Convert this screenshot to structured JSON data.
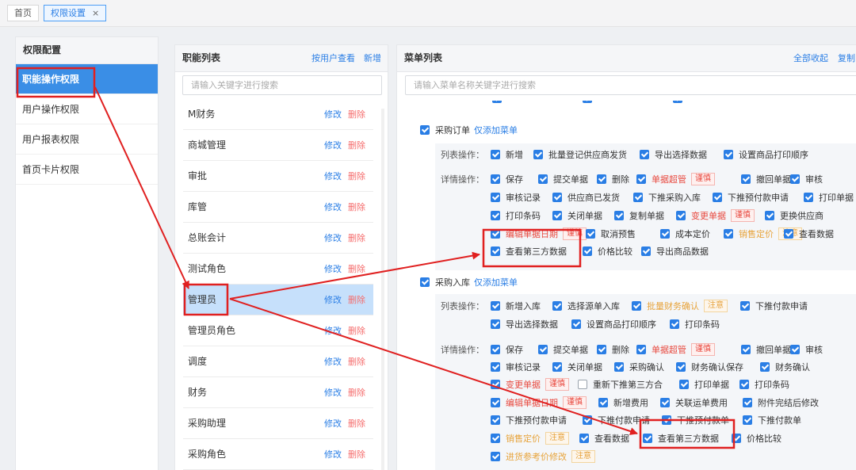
{
  "tabs": [
    {
      "label": "首页"
    },
    {
      "label": "权限设置",
      "close": "×"
    }
  ],
  "left_panel": {
    "title": "权限配置",
    "items": [
      "职能操作权限",
      "用户操作权限",
      "用户报表权限",
      "首页卡片权限"
    ]
  },
  "roles_panel": {
    "title": "职能列表",
    "by_user": "按用户查看",
    "add": "新增",
    "search_placeholder": "请输入关键字进行搜索",
    "edit_label": "修改",
    "delete_label": "删除",
    "roles": [
      "M财务",
      "商城管理",
      "审批",
      "库管",
      "总账会计",
      "测试角色",
      "管理员",
      "管理员角色",
      "调度",
      "财务",
      "采购助理",
      "采购角色"
    ]
  },
  "menu_panel": {
    "title": "菜单列表",
    "collapse_all": "全部收起",
    "copy": "复制",
    "search_placeholder": "请输入菜单名称关键字进行搜索",
    "list_ops_label": "列表操作：",
    "detail_ops_label": "详情操作：",
    "only_add_menu": "仅添加菜单",
    "purchase_order": {
      "title": "采购订单",
      "list_ops": [
        "新增",
        "批量登记供应商发货",
        "导出选择数据",
        "设置商品打印顺序"
      ],
      "detail_ops": [
        [
          "保存",
          "提交单据",
          "删除",
          "单据超管",
          "撤回单据",
          "审核"
        ],
        [
          "审核记录",
          "供应商已发货",
          "下推采购入库",
          "下推预付款申请",
          "打印单据"
        ],
        [
          "打印条码",
          "关闭单据",
          "复制单据",
          "变更单据",
          "更换供应商"
        ],
        [
          "编辑单据日期",
          "取消预售",
          "成本定价",
          "销售定价",
          "查看数据"
        ],
        [
          "查看第三方数据",
          "价格比较",
          "导出商品数据"
        ]
      ]
    },
    "purchase_in": {
      "title": "采购入库",
      "list_ops": [
        [
          "新增入库",
          "选择源单入库",
          "批量财务确认",
          "下推付款申请"
        ],
        [
          "导出选择数据",
          "设置商品打印顺序",
          "打印条码"
        ]
      ],
      "detail_ops": [
        [
          "保存",
          "提交单据",
          "删除",
          "单据超管",
          "撤回单据",
          "审核"
        ],
        [
          "审核记录",
          "关闭单据",
          "采购确认",
          "财务确认保存",
          "财务确认"
        ],
        [
          "变更单据",
          "重新下推第三方合",
          "打印单据",
          "打印条码"
        ],
        [
          "编辑单据日期",
          "新增费用",
          "关联运单费用",
          "附件完结后修改"
        ],
        [
          "下推预付款申请",
          "下推付款申请",
          "下推预付款单",
          "下推付款单"
        ],
        [
          "销售定价",
          "查看数据",
          "查看第三方数据",
          "价格比较"
        ],
        [
          "进货参考价修改"
        ]
      ]
    },
    "tags": {
      "caution": "谨慎",
      "notice": "注意"
    }
  },
  "colors": {
    "accent": "#2a7ee5",
    "danger": "#e8493f",
    "warning": "#e6a23c",
    "annotation": "#e02020"
  }
}
